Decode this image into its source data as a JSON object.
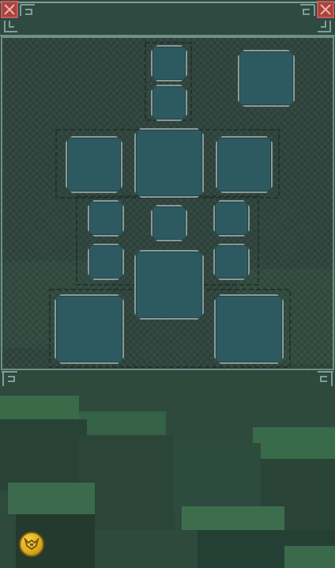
{
  "screen": "armor-equipment-panel",
  "colors": {
    "background": "#2c463c",
    "panel_border": "#6f8f87",
    "slot_fill": "#2d5a60",
    "slot_border": "#8a9a98",
    "corner_button": "#a8433f",
    "coin": "#e0b42a"
  },
  "header": {
    "left_button_icon": "close-x-icon",
    "right_button_icon": "close-x-icon"
  },
  "slots": [
    {
      "id": "head-top"
    },
    {
      "id": "head"
    },
    {
      "id": "extra"
    },
    {
      "id": "left-shoulder"
    },
    {
      "id": "chest"
    },
    {
      "id": "right-shoulder"
    },
    {
      "id": "left-upper-arm"
    },
    {
      "id": "neck"
    },
    {
      "id": "right-upper-arm"
    },
    {
      "id": "left-hand"
    },
    {
      "id": "waist"
    },
    {
      "id": "right-hand"
    },
    {
      "id": "left-foot"
    },
    {
      "id": "right-foot"
    }
  ],
  "footer": {
    "coin_icon": "gold-coin-face-icon"
  }
}
